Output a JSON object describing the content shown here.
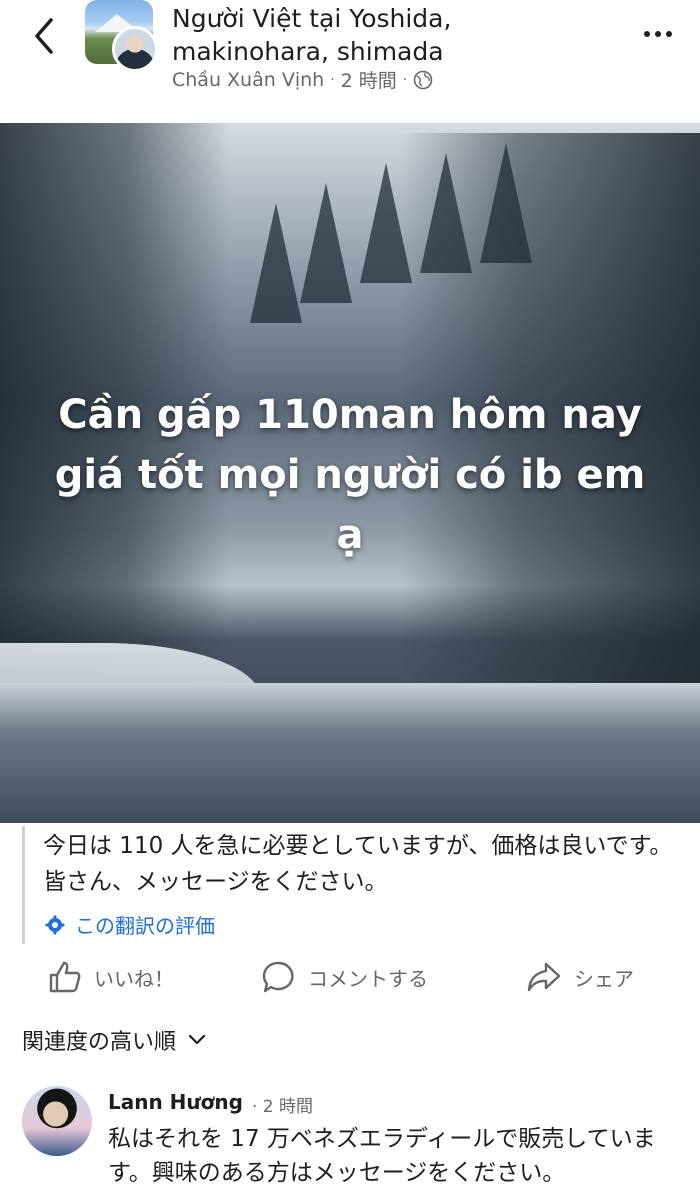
{
  "header": {
    "group_name": "Người Việt tại Yoshida, makinohara, shimada",
    "author": "Chầu Xuân Vịnh",
    "separator": "·",
    "time": "2 時間",
    "separator2": "·"
  },
  "post": {
    "overlay_text": "Cần gấp 110man hôm nay giá tốt mọi người có ib em ạ",
    "translation": "今日は 110 人を急に必要としていますが、価格は良いです。皆さん、メッセージをください。",
    "rate_translation": "この翻訳の評価"
  },
  "actions": {
    "like": "いいね！",
    "comment": "コメントする",
    "share": "シェア"
  },
  "sort": {
    "label": "関連度の高い順"
  },
  "comment": {
    "name": "Lann Hương",
    "time": "· 2 時間",
    "text": "私はそれを 17 万ベネズエラディールで販売しています。興味のある方はメッセージをください。"
  },
  "colors": {
    "link_blue": "#216fdb",
    "secondary_text": "#65676b"
  }
}
